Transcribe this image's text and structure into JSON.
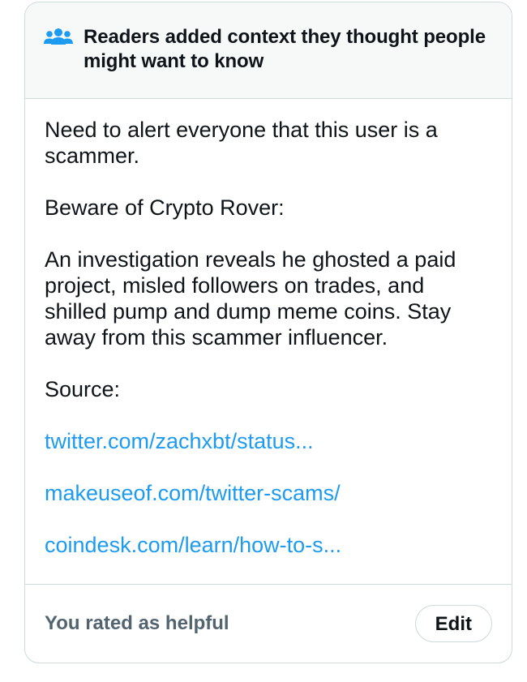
{
  "note": {
    "header": {
      "icon": "people-group-icon",
      "title": "Readers added context they thought people might want to know"
    },
    "body": {
      "paragraphs": [
        "Need to alert everyone that this user is a scammer.",
        "Beware of Crypto Rover:",
        "An investigation reveals he ghosted a paid project, misled followers on trades, and shilled pump and dump meme coins. Stay away from this scammer influencer.",
        "Source:"
      ],
      "links": [
        "twitter.com/zachxbt/status...",
        "makeuseof.com/twitter-scams/",
        "coindesk.com/learn/how-to-s..."
      ]
    },
    "footer": {
      "rated_text": "You rated as helpful",
      "edit_label": "Edit"
    }
  },
  "colors": {
    "accent": "#1d9bf0",
    "text_primary": "#0f1419",
    "text_secondary": "#536471",
    "border": "#cfd9de",
    "header_bg": "#f7f9f9"
  }
}
